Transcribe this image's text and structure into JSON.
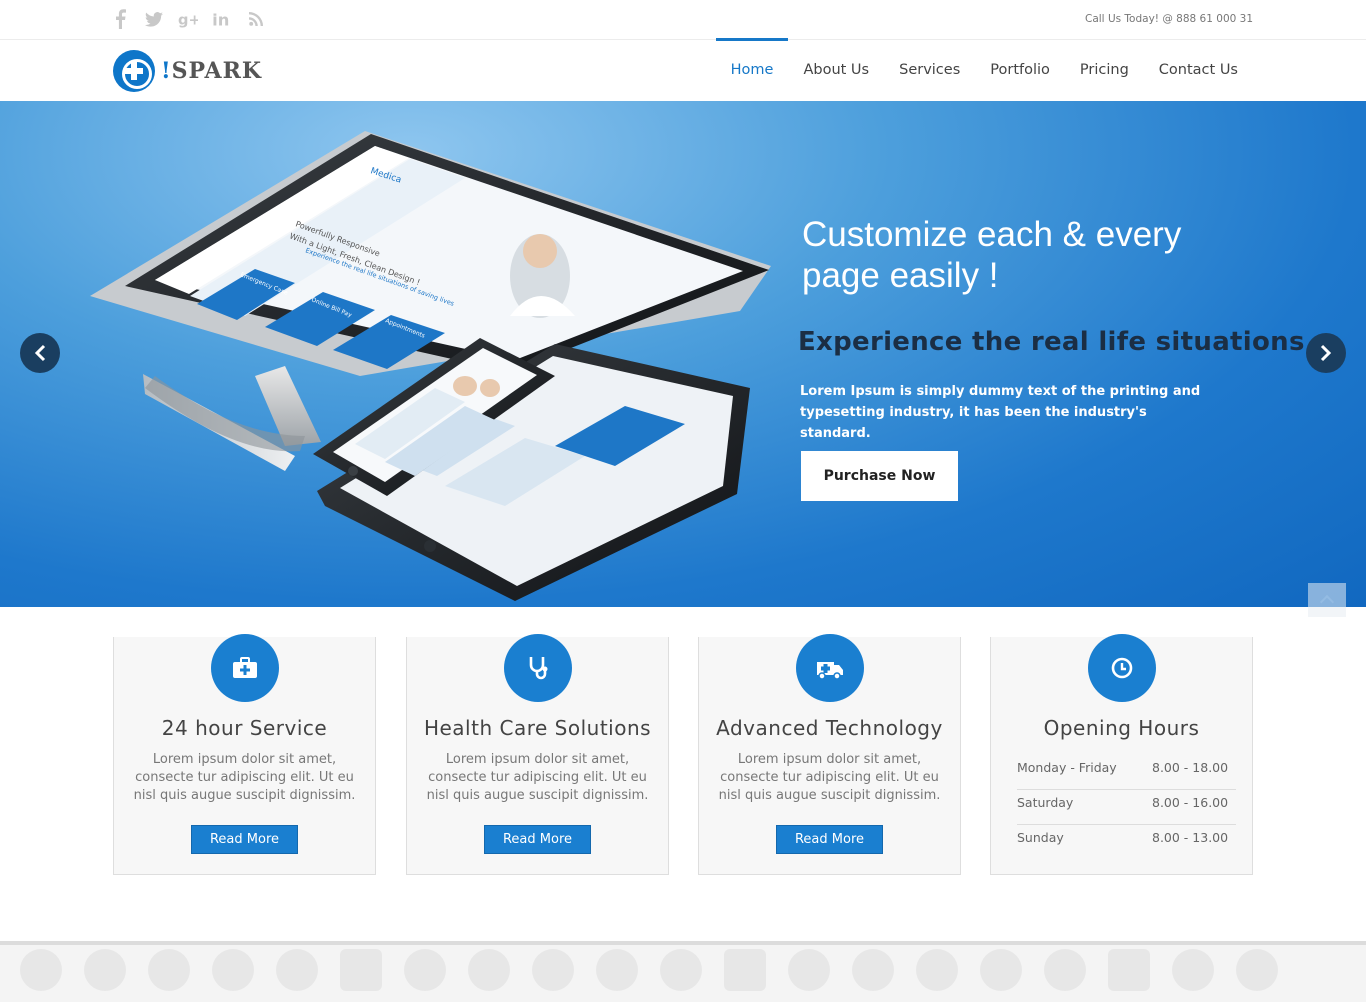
{
  "topbar": {
    "social_icons": [
      "facebook-icon",
      "twitter-icon",
      "google-plus-icon",
      "linkedin-icon",
      "rss-icon"
    ],
    "call_text": "Call Us Today! @ 888 61 000 31"
  },
  "brand": {
    "bang": "!",
    "name": "SPARK"
  },
  "nav": {
    "items": [
      {
        "label": "Home",
        "active": true
      },
      {
        "label": "About Us"
      },
      {
        "label": "Services"
      },
      {
        "label": "Portfolio"
      },
      {
        "label": "Pricing"
      },
      {
        "label": "Contact Us"
      }
    ]
  },
  "hero": {
    "headline": "Customize each & every page easily !",
    "subheadline": "Experience the real life situations",
    "text": "Lorem Ipsum is simply dummy text of the printing and typesetting industry, it has been the industry's standard.",
    "button": "Purchase Now",
    "device_screen": {
      "brand": "Medica",
      "tagline1": "Powerfully Responsive",
      "tagline2": "With a Light, Fresh, Clean Design !",
      "tagline3": "Experience the real life situations of saving lives",
      "box1": "Emergency Case",
      "box2": "Online Bill Pay",
      "box3": "Appointments"
    }
  },
  "features": [
    {
      "icon": "first-aid-kit-icon",
      "title": "24 hour Service",
      "text": "Lorem ipsum dolor sit amet, consecte tur adipiscing elit. Ut eu nisl quis augue suscipit dignissim.",
      "button": "Read More"
    },
    {
      "icon": "stethoscope-icon",
      "title": "Health Care Solutions",
      "text": "Lorem ipsum dolor sit amet, consecte tur adipiscing elit. Ut eu nisl quis augue suscipit dignissim.",
      "button": "Read More"
    },
    {
      "icon": "ambulance-icon",
      "title": "Advanced Technology",
      "text": "Lorem ipsum dolor sit amet, consecte tur adipiscing elit. Ut eu nisl quis augue suscipit dignissim.",
      "button": "Read More"
    }
  ],
  "opening_hours": {
    "icon": "clock-icon",
    "title": "Opening Hours",
    "rows": [
      {
        "day": "Monday - Friday",
        "time": "8.00 - 18.00"
      },
      {
        "day": "Saturday",
        "time": "8.00 - 16.00"
      },
      {
        "day": "Sunday",
        "time": "8.00 - 13.00"
      }
    ]
  },
  "colors": {
    "accent": "#1a7fd0",
    "nav_active": "#1678c8",
    "hero_dark_text": "#1b2e44"
  }
}
